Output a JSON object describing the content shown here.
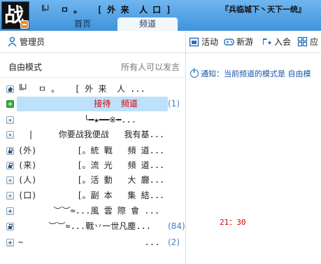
{
  "header": {
    "title": "╚┘  ㅁ 。   [ 外 来  人 口 ]",
    "banner": "『兵临城下丶天下一统』",
    "tabs": [
      {
        "label": "首页"
      },
      {
        "label": "频道"
      }
    ]
  },
  "toolbar": {
    "admin": "管理员",
    "activity": "活动",
    "new_game": "新游",
    "join": "入会",
    "more": "应"
  },
  "left": {
    "mode_label": "自由模式",
    "mode_hint": "所有人可以发言",
    "rows": [
      {
        "name": "╚┘  ㅁ 。   [ 外 来  人 ...",
        "count": ""
      },
      {
        "name": "               接待  频道",
        "count": "(1)"
      },
      {
        "name": "             ╰━★━━※━...",
        "count": ""
      },
      {
        "name": "  |     你要战我便战   我有基...",
        "count": ""
      },
      {
        "name": "(外)        [。統 戰   頻 道...",
        "count": ""
      },
      {
        "name": "(来)        [。流 光   頻 道...",
        "count": ""
      },
      {
        "name": "(人)        [。活 動   大 廳...",
        "count": ""
      },
      {
        "name": "(口)        [。副 本   集 結...",
        "count": ""
      },
      {
        "name": "       ︶︶≈...風 雲 際 會 ...",
        "count": ""
      },
      {
        "name": "      ︶︶≈...戰丷一世凡塵...",
        "count": "(84)"
      },
      {
        "name": "~                        ...",
        "count": "(2)"
      }
    ]
  },
  "right": {
    "notice": "通知：当前频道的模式是 自由模",
    "time": "21：30"
  }
}
